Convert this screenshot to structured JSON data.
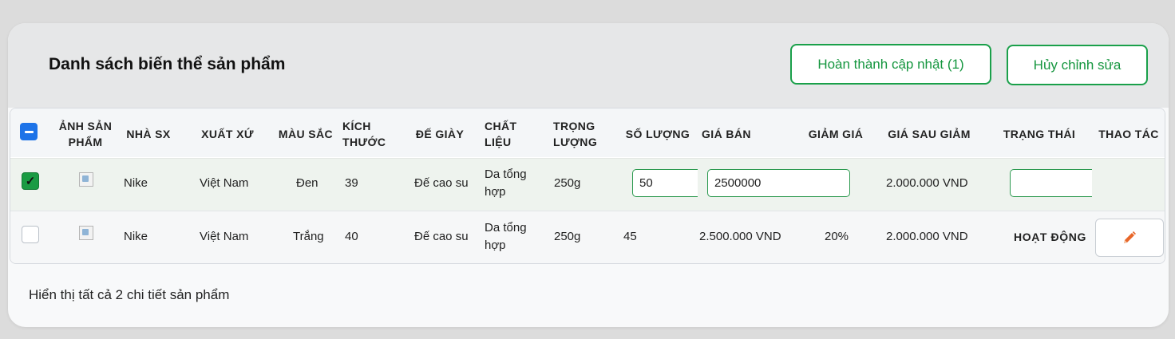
{
  "header": {
    "title": "Danh sách biến thể sản phẩm",
    "finish_button": "Hoàn thành cập nhật (1)",
    "cancel_button": "Hủy chỉnh sửa"
  },
  "table": {
    "columns": {
      "image": "ẢNH SẢN PHẨM",
      "brand": "NHÀ SX",
      "origin": "XUẤT XỨ",
      "color": "MÀU SẮC",
      "size": "KÍCH THƯỚC",
      "sole": "ĐẾ GIÀY",
      "material": "CHẤT LIỆU",
      "weight": "TRỌNG LƯỢNG",
      "quantity": "SỐ LƯỢNG",
      "price": "GIÁ BÁN",
      "discount": "GIẢM GIÁ",
      "final_price": "GIÁ SAU GIẢM",
      "status": "TRẠNG THÁI",
      "actions": "THAO TÁC"
    },
    "rows": [
      {
        "checked": true,
        "brand": "Nike",
        "origin": "Việt Nam",
        "color": "Đen",
        "size": "39",
        "sole": "Đế cao su",
        "material": "Da tổng hợp",
        "weight": "250g",
        "quantity_input": "50",
        "price_input": "2500000",
        "final_price": "2.000.000 VND",
        "status_input": ""
      },
      {
        "checked": false,
        "brand": "Nike",
        "origin": "Việt Nam",
        "color": "Trắng",
        "size": "40",
        "sole": "Đế cao su",
        "material": "Da tổng hợp",
        "weight": "250g",
        "quantity": "45",
        "price": "2.500.000 VND",
        "discount": "20%",
        "final_price": "2.000.000 VND",
        "status": "HOẠT ĐỘNG",
        "action_icon": "pencil-icon"
      }
    ]
  },
  "footer": {
    "summary": "Hiển thị tất cả 2 chi tiết sản phẩm"
  },
  "colors": {
    "accent_green": "#1aa04a",
    "checkbox_blue": "#1d73e8",
    "edit_orange": "#e8672a"
  }
}
